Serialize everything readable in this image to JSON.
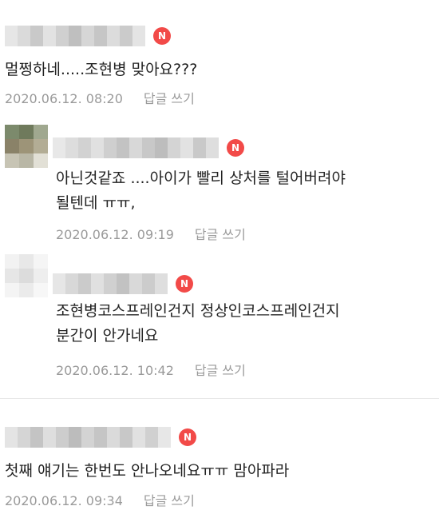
{
  "badge_label": "N",
  "colors": {
    "badge": "#f24a48",
    "meta_text": "#9a9a9a",
    "body_text": "#222222"
  },
  "comments": [
    {
      "is_reply": false,
      "nickname": "",
      "text_lines": [
        "멀쩡하네.....조현병 맞아요???"
      ],
      "date": "2020.06.12. 08:20",
      "reply_label": "답글 쓰기"
    },
    {
      "is_reply": true,
      "nickname": "",
      "text_lines": [
        "아닌것같죠 ....아이가 빨리 상처를 털어버려야",
        "될텐데 ㅠㅠ,"
      ],
      "date": "2020.06.12. 09:19",
      "reply_label": "답글 쓰기"
    },
    {
      "is_reply": true,
      "nickname": "",
      "text_lines": [
        "조현병코스프레인건지 정상인코스프레인건지",
        "분간이 안가네요"
      ],
      "date": "2020.06.12. 10:42",
      "reply_label": "답글 쓰기"
    },
    {
      "is_reply": false,
      "nickname": "",
      "text_lines": [
        "첫째 얘기는 한번도 안나오네요ㅠㅠ 맘아파라"
      ],
      "date": "2020.06.12. 09:34",
      "reply_label": "답글 쓰기"
    }
  ]
}
